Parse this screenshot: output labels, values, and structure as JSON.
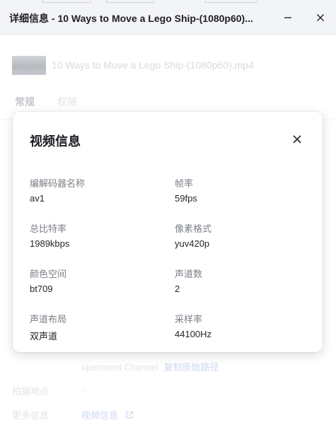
{
  "window": {
    "title": "详细信息 - 10 Ways to Move a Lego Ship-(1080p60)...",
    "minimize_icon": "minimize-icon",
    "close_icon": "close-icon"
  },
  "file": {
    "name": "10 Ways to Move a Lego Ship-(1080p60).mp4"
  },
  "tabs": [
    {
      "label": "常规",
      "active": true
    },
    {
      "label": "权限",
      "active": false
    }
  ],
  "background_details": {
    "source_fragment_1": "xperiment Channel",
    "copy_path_link": "复制原始路径",
    "location_label": "拍摄地点",
    "location_value": "-",
    "more_info_label": "更多信息",
    "video_info_link": "视频信息",
    "external_icon": "external-link-icon"
  },
  "modal": {
    "title": "视频信息",
    "close_icon": "close-icon",
    "fields": [
      {
        "label": "编解码器名称",
        "value": "av1"
      },
      {
        "label": "帧率",
        "value": "59fps"
      },
      {
        "label": "总比特率",
        "value": "1989kbps"
      },
      {
        "label": "像素格式",
        "value": "yuv420p"
      },
      {
        "label": "颜色空间",
        "value": "bt709"
      },
      {
        "label": "声道数",
        "value": "2"
      },
      {
        "label": "声道布局",
        "value": "双声道"
      },
      {
        "label": "采样率",
        "value": "44100Hz"
      }
    ]
  },
  "colors": {
    "title_bar": "#f3f4f7",
    "link": "#b3c3ea",
    "label": "#7b7f86",
    "value": "#25272b"
  }
}
